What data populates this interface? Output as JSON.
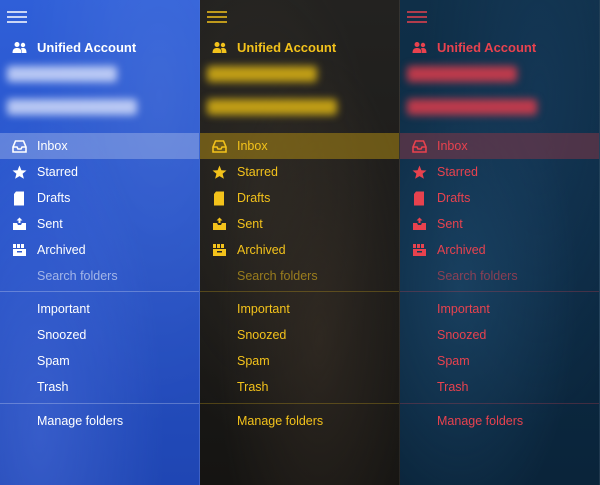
{
  "panels": [
    {
      "theme": "blue",
      "accent": "#ffffff",
      "selected_bg": "rgba(255,255,255,0.25)",
      "blur_color": "rgba(230,235,255,0.75)"
    },
    {
      "theme": "dark",
      "accent": "#f3c21b",
      "selected_bg": "rgba(170,135,20,0.55)",
      "blur_color": "rgba(220,180,20,0.85)"
    },
    {
      "theme": "navy",
      "accent": "#e8424e",
      "selected_bg": "rgba(130,55,70,0.55)",
      "blur_color": "rgba(220,60,75,0.85)"
    }
  ],
  "account": {
    "title": "Unified Account",
    "icon": "people-icon"
  },
  "nav": {
    "items": [
      {
        "label": "Inbox",
        "icon": "inbox-tray-icon",
        "selected": true
      },
      {
        "label": "Starred",
        "icon": "star-icon",
        "selected": false
      },
      {
        "label": "Drafts",
        "icon": "draft-page-icon",
        "selected": false
      },
      {
        "label": "Sent",
        "icon": "sent-tray-icon",
        "selected": false
      },
      {
        "label": "Archived",
        "icon": "archive-box-icon",
        "selected": false
      }
    ]
  },
  "search": {
    "placeholder": "Search folders"
  },
  "folders": [
    "Important",
    "Snoozed",
    "Spam",
    "Trash"
  ],
  "manage_label": "Manage folders"
}
